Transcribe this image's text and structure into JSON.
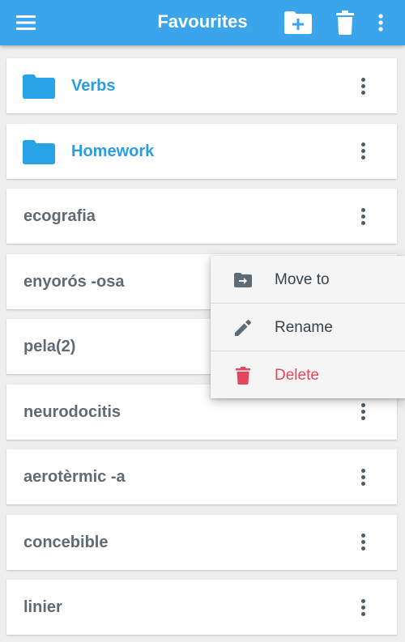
{
  "app_bar": {
    "title": "Favourites",
    "color": "#3aa5ea",
    "icons": [
      "menu-icon",
      "new-folder-icon",
      "trash-icon",
      "more-vert-icon"
    ]
  },
  "list": {
    "folders": [
      {
        "label": "Verbs",
        "icon": "folder-icon"
      },
      {
        "label": "Homework",
        "icon": "folder-icon"
      }
    ],
    "words": [
      "ecografia",
      "enyorós -osa",
      "pela(2)",
      "neurodocitis",
      "aerotèrmic -a",
      "concebible",
      "linier"
    ]
  },
  "context_menu": {
    "items": [
      {
        "label": "Move to",
        "icon": "move-to-icon"
      },
      {
        "label": "Rename",
        "icon": "pencil-icon"
      },
      {
        "label": "Delete",
        "icon": "trash-icon",
        "color": "#e2475d"
      }
    ]
  }
}
